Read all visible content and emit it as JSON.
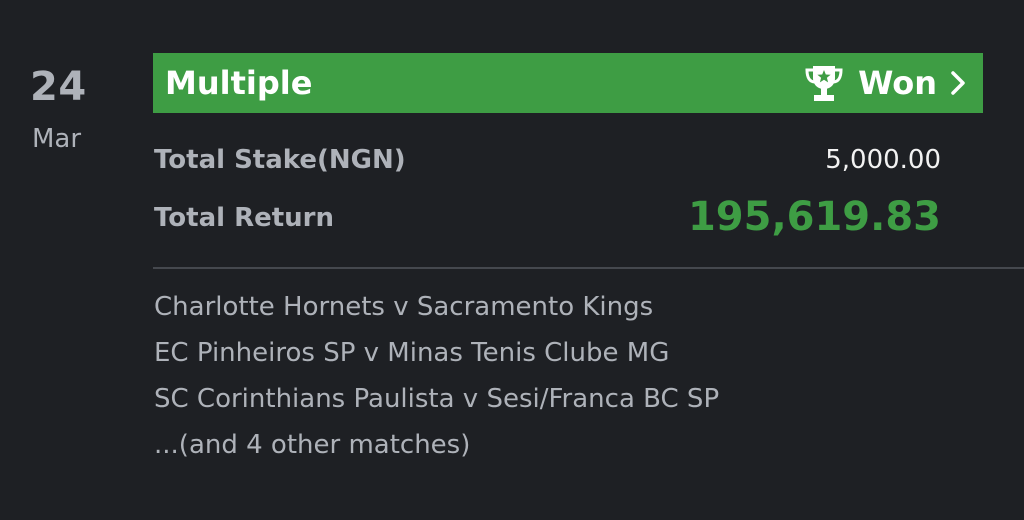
{
  "date": {
    "day": "24",
    "month": "Mar"
  },
  "bet": {
    "type_label": "Multiple",
    "status_label": "Won",
    "status_color": "#3e9d44",
    "icons": [
      "trophy-icon",
      "chevron-right-icon"
    ]
  },
  "stake": {
    "label": "Total Stake(NGN)",
    "value": "5,000.00"
  },
  "return": {
    "label": "Total Return",
    "value": "195,619.83"
  },
  "matches": [
    "Charlotte Hornets v Sacramento Kings",
    "EC Pinheiros SP v Minas Tenis Clube MG",
    "SC Corinthians Paulista v Sesi/Franca BC SP",
    "...(and 4 other matches)"
  ]
}
